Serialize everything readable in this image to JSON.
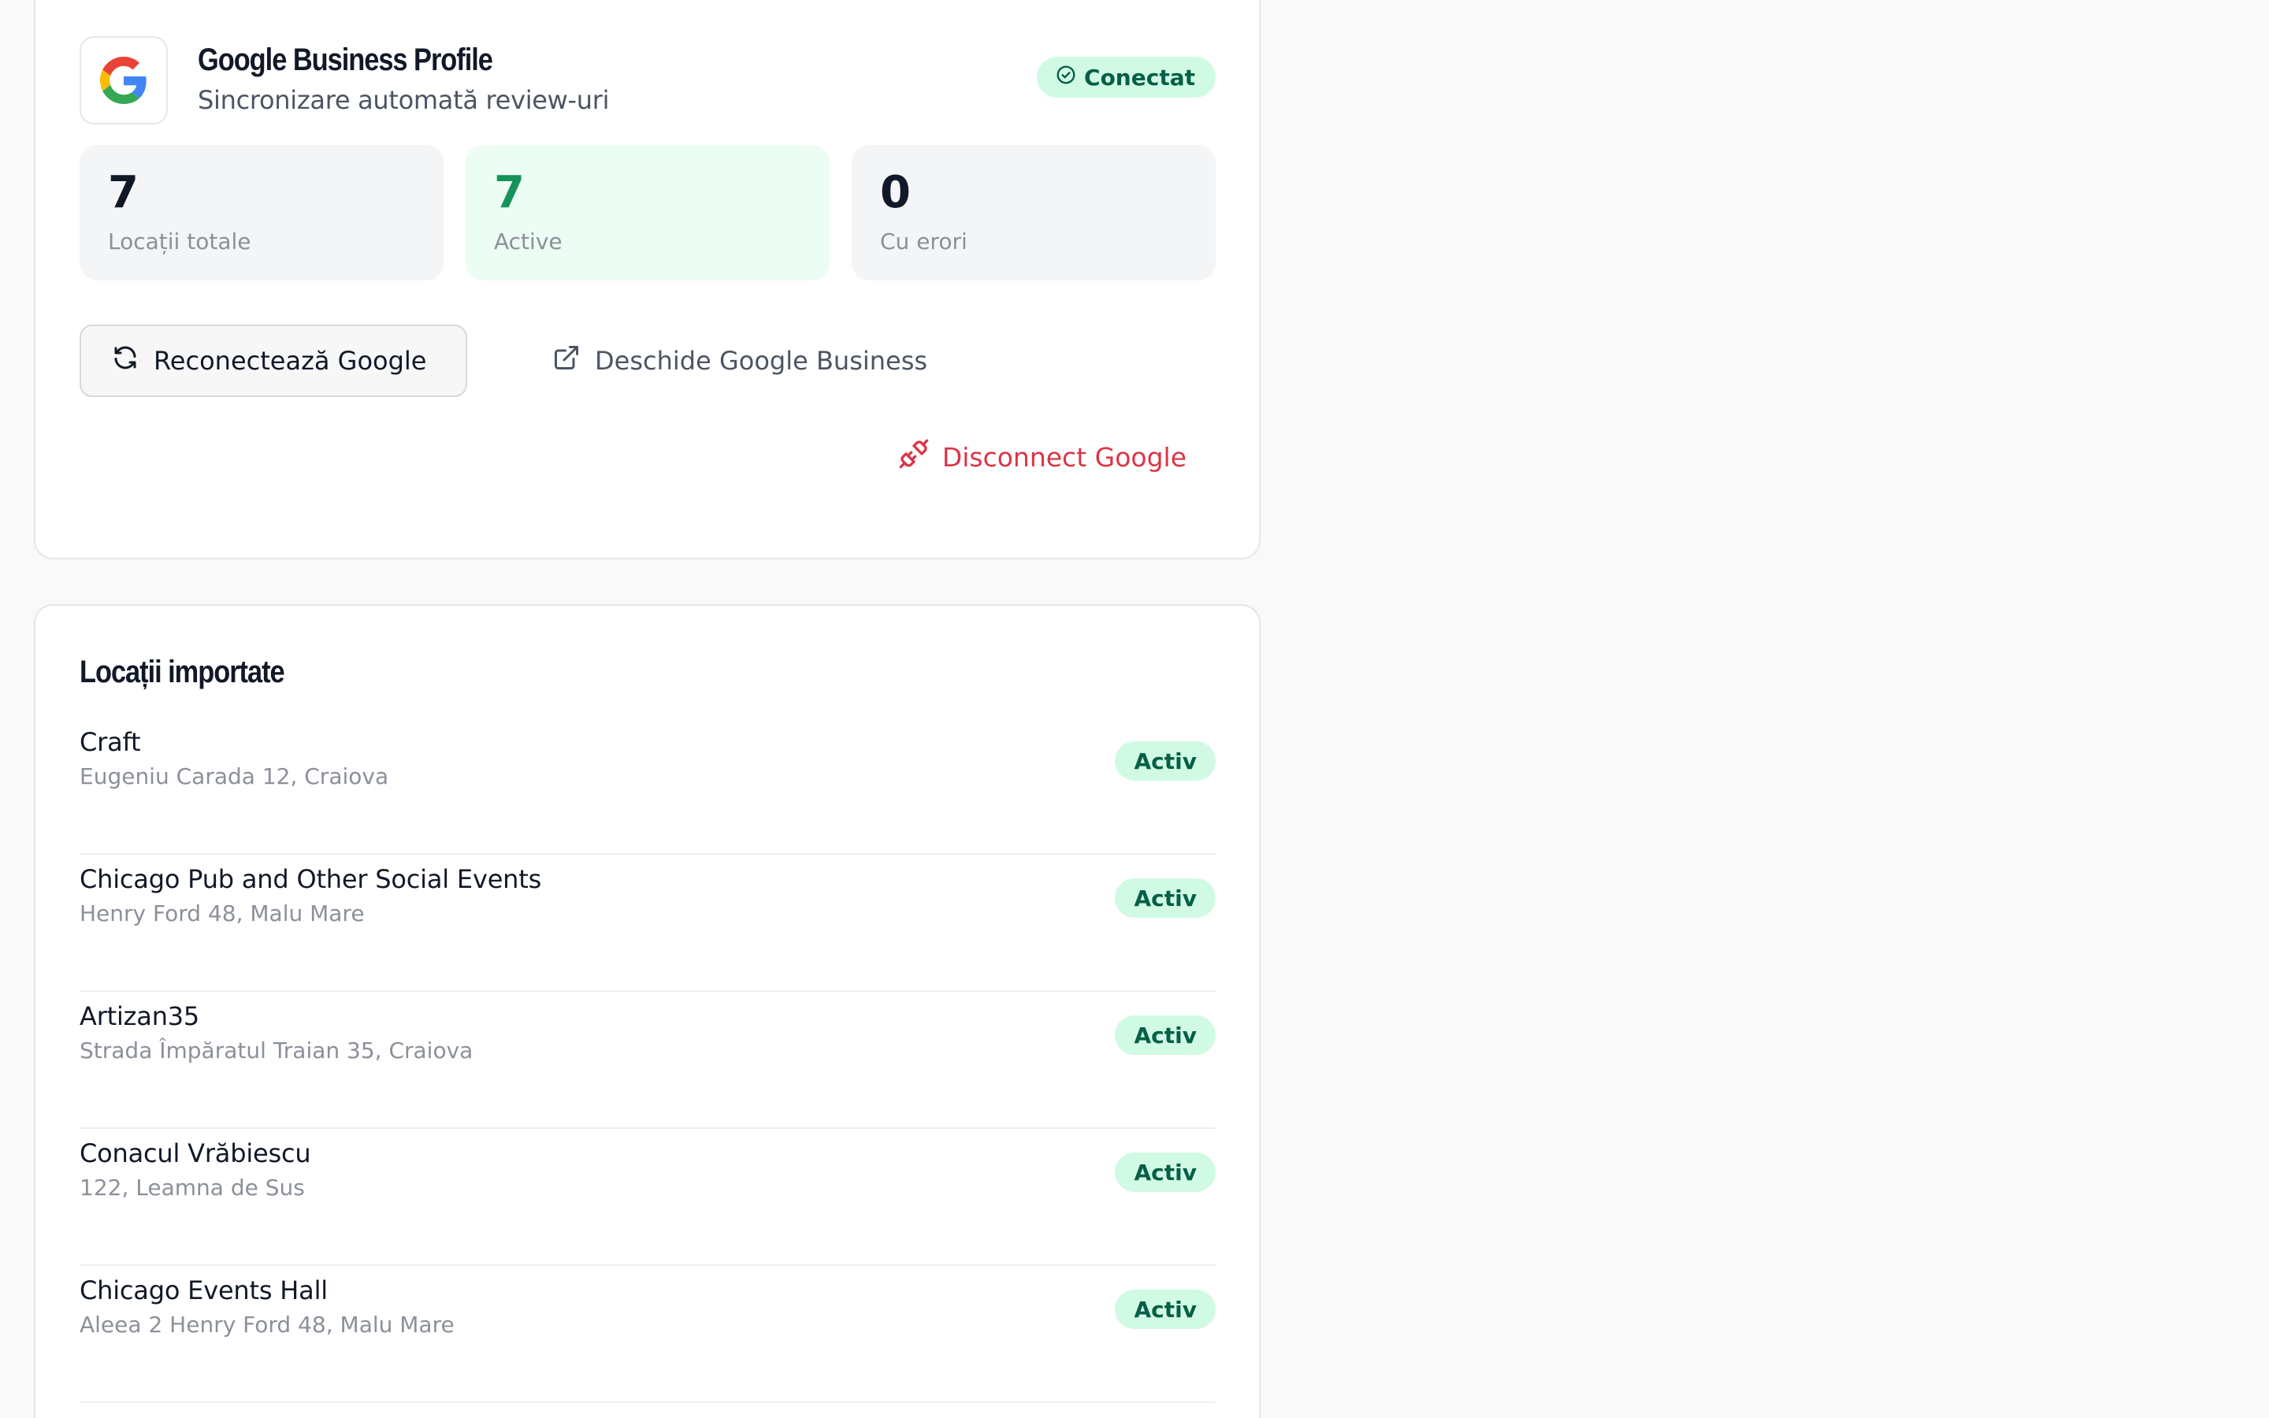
{
  "google_profile": {
    "title": "Google Business Profile",
    "subtitle": "Sincronizare automată review-uri",
    "status": "Conectat",
    "logo_icon": "google-g-icon"
  },
  "stats": [
    {
      "value": "7",
      "label": "Locații totale"
    },
    {
      "value": "7",
      "label": "Active"
    },
    {
      "value": "0",
      "label": "Cu erori"
    }
  ],
  "actions": {
    "reconnect": "Reconectează Google",
    "open_business": "Deschide Google Business",
    "disconnect": "Disconnect Google"
  },
  "locations": {
    "title": "Locații importate",
    "items": [
      {
        "name": "Craft",
        "address": "Eugeniu Carada 12, Craiova",
        "status": "Activ"
      },
      {
        "name": "Chicago Pub and Other Social Events",
        "address": "Henry Ford 48, Malu Mare",
        "status": "Activ"
      },
      {
        "name": "Artizan35",
        "address": "Strada Împăratul Traian 35, Craiova",
        "status": "Activ"
      },
      {
        "name": "Conacul Vrăbiescu",
        "address": "122, Leamna de Sus",
        "status": "Activ"
      },
      {
        "name": "Chicago Events Hall",
        "address": "Aleea 2 Henry Ford 48, Malu Mare",
        "status": "Activ"
      }
    ]
  },
  "colors": {
    "success_bg": "#d1fae5",
    "success_text": "#065f46",
    "danger": "#dc3545",
    "active_value": "#16935a"
  }
}
